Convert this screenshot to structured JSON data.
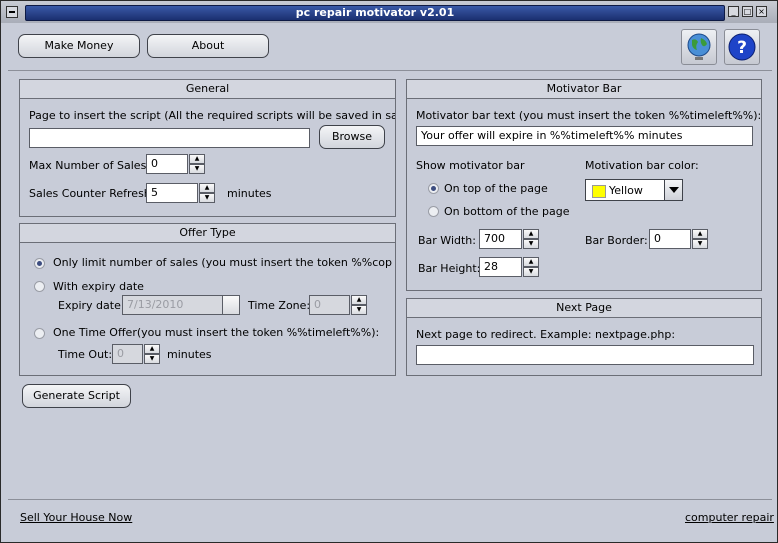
{
  "window": {
    "title": "pc repair motivator v2.01"
  },
  "toolbar": {
    "make_money": "Make Money",
    "about": "About"
  },
  "general": {
    "header": "General",
    "page_label": "Page to insert the script (All the required scripts will be saved in same folder",
    "page_value": "",
    "browse": "Browse",
    "max_sales_label": "Max Number of Sales:",
    "max_sales_value": "0",
    "refresh_label": "Sales Counter Refresh:",
    "refresh_value": "5",
    "refresh_unit": "minutes"
  },
  "offer": {
    "header": "Offer Type",
    "opt1": "Only limit number of sales (you must insert the token %%copiesleft%'",
    "opt2": "With expiry date",
    "expiry_label": "Expiry date:",
    "expiry_value": "7/13/2010",
    "tz_label": "Time Zone:",
    "tz_value": "0",
    "opt3": "One Time Offer(you must insert the token %%timeleft%%):",
    "timeout_label": "Time Out:",
    "timeout_value": "0",
    "timeout_unit": "minutes",
    "selected": 1
  },
  "generate": "Generate Script",
  "motivator": {
    "header": "Motivator Bar",
    "text_label": "Motivator bar text (you must insert the token %%timeleft%%):",
    "text_value": "Your offer will expire in %%timeleft%% minutes",
    "show_label": "Show motivator bar",
    "pos_top": "On top of the page",
    "pos_bottom": "On bottom of the page",
    "color_label": "Motivation bar color:",
    "color_value": "Yellow",
    "color_hex": "#ffff00",
    "width_label": "Bar Width:",
    "width_value": "700",
    "height_label": "Bar Height:",
    "height_value": "28",
    "border_label": "Bar Border:",
    "border_value": "0"
  },
  "next_page": {
    "header": "Next Page",
    "label": "Next page to redirect. Example: nextpage.php:",
    "value": ""
  },
  "footer": {
    "left_link": "Sell Your House Now",
    "right_link": "computer repair"
  }
}
